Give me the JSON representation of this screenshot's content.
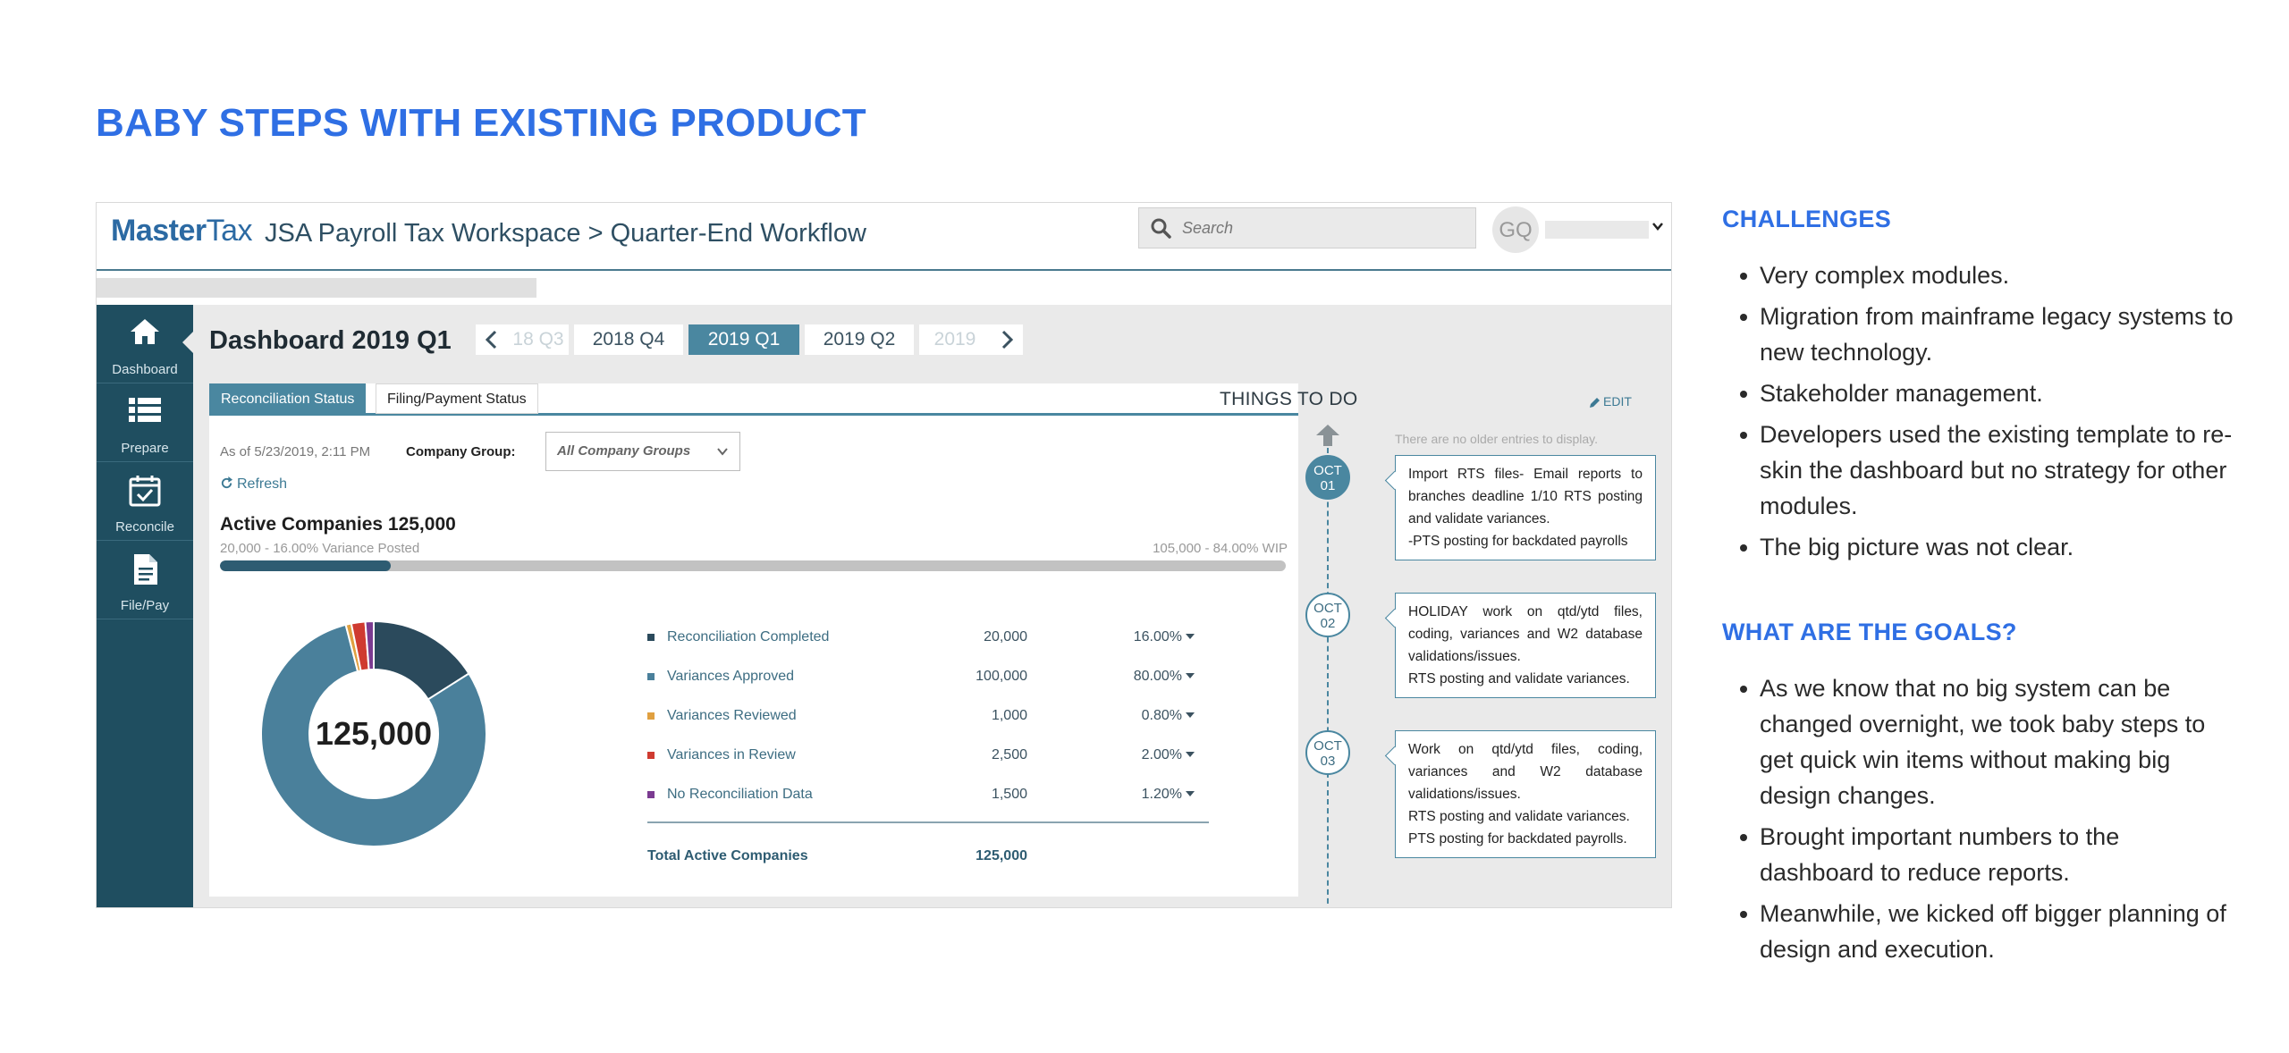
{
  "page_title": "BABY STEPS WITH EXISTING PRODUCT",
  "app": {
    "logo_master": "Master",
    "logo_tax": "Tax",
    "title": "JSA Payroll Tax Workspace > Quarter-End Workflow",
    "search_placeholder": "Search",
    "avatar_initials": "GQ"
  },
  "sidebar": {
    "items": [
      {
        "label": "Dashboard",
        "icon": "home-icon"
      },
      {
        "label": "Prepare",
        "icon": "list-icon"
      },
      {
        "label": "Reconcile",
        "icon": "calendar-check-icon"
      },
      {
        "label": "File/Pay",
        "icon": "document-icon"
      }
    ]
  },
  "dashboard": {
    "title": "Dashboard 2019 Q1",
    "quarters": [
      "18 Q3",
      "2018 Q4",
      "2019 Q1",
      "2019 Q2",
      "2019"
    ],
    "active_quarter": "2019 Q1",
    "tabs": [
      "Reconciliation Status",
      "Filing/Payment Status"
    ],
    "as_of": "As of 5/23/2019, 2:11 PM",
    "company_group_label": "Company Group:",
    "company_group_value": "All Company Groups",
    "refresh_label": "Refresh",
    "active_companies_title": "Active Companies 125,000",
    "variance_posted": "20,000 - 16.00% Variance Posted",
    "wip": "105,000 - 84.00% WIP",
    "progress_fraction": 0.16,
    "donut_center": "125,000",
    "legend": [
      {
        "label": "Reconciliation Completed",
        "value": "20,000",
        "pct": "16.00%",
        "color": "#2b4a5c"
      },
      {
        "label": "Variances Approved",
        "value": "100,000",
        "pct": "80.00%",
        "color": "#4a809b"
      },
      {
        "label": "Variances Reviewed",
        "value": "1,000",
        "pct": "0.80%",
        "color": "#e0a040"
      },
      {
        "label": "Variances in Review",
        "value": "2,500",
        "pct": "2.00%",
        "color": "#cf3b30"
      },
      {
        "label": "No Reconciliation Data",
        "value": "1,500",
        "pct": "1.20%",
        "color": "#7b3b91"
      }
    ],
    "total_label": "Total Active Companies",
    "total_value": "125,000"
  },
  "chart_data": {
    "type": "pie",
    "categories": [
      "Reconciliation Completed",
      "Variances Approved",
      "Variances Reviewed",
      "Variances in Review",
      "No Reconciliation Data"
    ],
    "values": [
      20000,
      100000,
      1000,
      2500,
      1500
    ],
    "colors": [
      "#2b4a5c",
      "#4a809b",
      "#e0a040",
      "#cf3b30",
      "#7b3b91"
    ]
  },
  "todo": {
    "title": "THINGS TO DO",
    "edit_label": "EDIT",
    "older_note": "There are no older entries to display.",
    "entries": [
      {
        "month": "OCT",
        "day": "01",
        "lines": [
          "Import RTS files- Email reports to branches deadline 1/10 RTS posting and validate variances.",
          "-PTS posting for backdated payrolls"
        ]
      },
      {
        "month": "OCT",
        "day": "02",
        "lines": [
          "HOLIDAY work on qtd/ytd files, coding, variances and W2 database validations/issues.",
          "RTS posting and validate variances."
        ]
      },
      {
        "month": "OCT",
        "day": "03",
        "lines": [
          "Work on qtd/ytd files, coding, variances and W2 database validations/issues.",
          "RTS posting and validate variances.",
          "PTS posting for backdated payrolls."
        ]
      }
    ]
  },
  "challenges": {
    "heading": "CHALLENGES",
    "items": [
      "Very complex modules.",
      "Migration from mainframe legacy systems to new technology.",
      "Stakeholder management.",
      "Developers used the existing template to re-skin the dashboard but no strategy for other modules.",
      "The big picture was not clear."
    ]
  },
  "goals": {
    "heading": "WHAT ARE THE GOALS?",
    "items": [
      "As we know that no big system can be changed overnight, we took baby steps to get quick win items without making big design changes.",
      "Brought important numbers to the dashboard to reduce reports.",
      "Meanwhile, we kicked off bigger planning of design and execution."
    ]
  }
}
